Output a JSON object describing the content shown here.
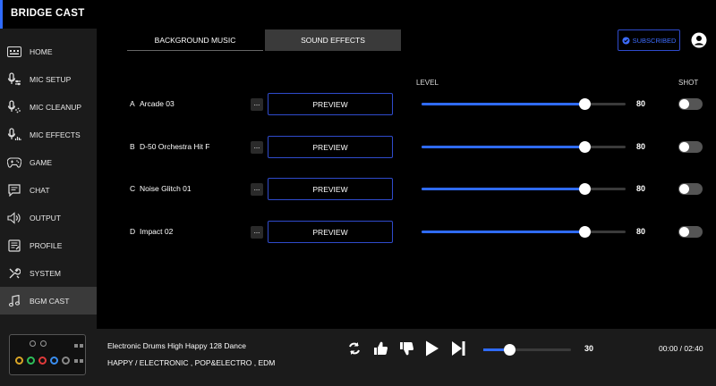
{
  "app": {
    "title": "BRIDGE CAST"
  },
  "sidebar": {
    "items": [
      {
        "label": "HOME",
        "icon": "home-icon"
      },
      {
        "label": "MIC SETUP",
        "icon": "mic-setup-icon"
      },
      {
        "label": "MIC CLEANUP",
        "icon": "mic-cleanup-icon"
      },
      {
        "label": "MIC EFFECTS",
        "icon": "mic-effects-icon"
      },
      {
        "label": "GAME",
        "icon": "gamepad-icon"
      },
      {
        "label": "CHAT",
        "icon": "chat-icon"
      },
      {
        "label": "OUTPUT",
        "icon": "speaker-icon"
      },
      {
        "label": "PROFILE",
        "icon": "profile-icon"
      },
      {
        "label": "SYSTEM",
        "icon": "wrench-icon"
      },
      {
        "label": "BGM CAST",
        "icon": "music-note-icon",
        "active": true
      }
    ]
  },
  "tabs": {
    "background_music": "BACKGROUND MUSIC",
    "sound_effects": "SOUND EFFECTS",
    "active": "sound_effects"
  },
  "header": {
    "subscribed_label": "SUBSCRIBED"
  },
  "columns": {
    "level": "LEVEL",
    "shot": "SHOT"
  },
  "effects": [
    {
      "letter": "A",
      "name": "Arcade 03",
      "more": "...",
      "preview": "PREVIEW",
      "level": 80,
      "shot": false
    },
    {
      "letter": "B",
      "name": "D-50 Orchestra Hit F",
      "more": "...",
      "preview": "PREVIEW",
      "level": 80,
      "shot": false
    },
    {
      "letter": "C",
      "name": "Noise Glitch 01",
      "more": "...",
      "preview": "PREVIEW",
      "level": 80,
      "shot": false
    },
    {
      "letter": "D",
      "name": "Impact 02",
      "more": "...",
      "preview": "PREVIEW",
      "level": 80,
      "shot": false
    }
  ],
  "player": {
    "title": "Electronic Drums High Happy 128 Dance",
    "genre": "HAPPY / ELECTRONIC , POP&ELECTRO , EDM",
    "volume": 30,
    "time": "00:00 / 02:40"
  },
  "colors": {
    "accent": "#2f6bff",
    "border": "#2f4bcc",
    "sidebar_bg": "#1b1b1b",
    "active_bg": "#3a3a3a"
  }
}
